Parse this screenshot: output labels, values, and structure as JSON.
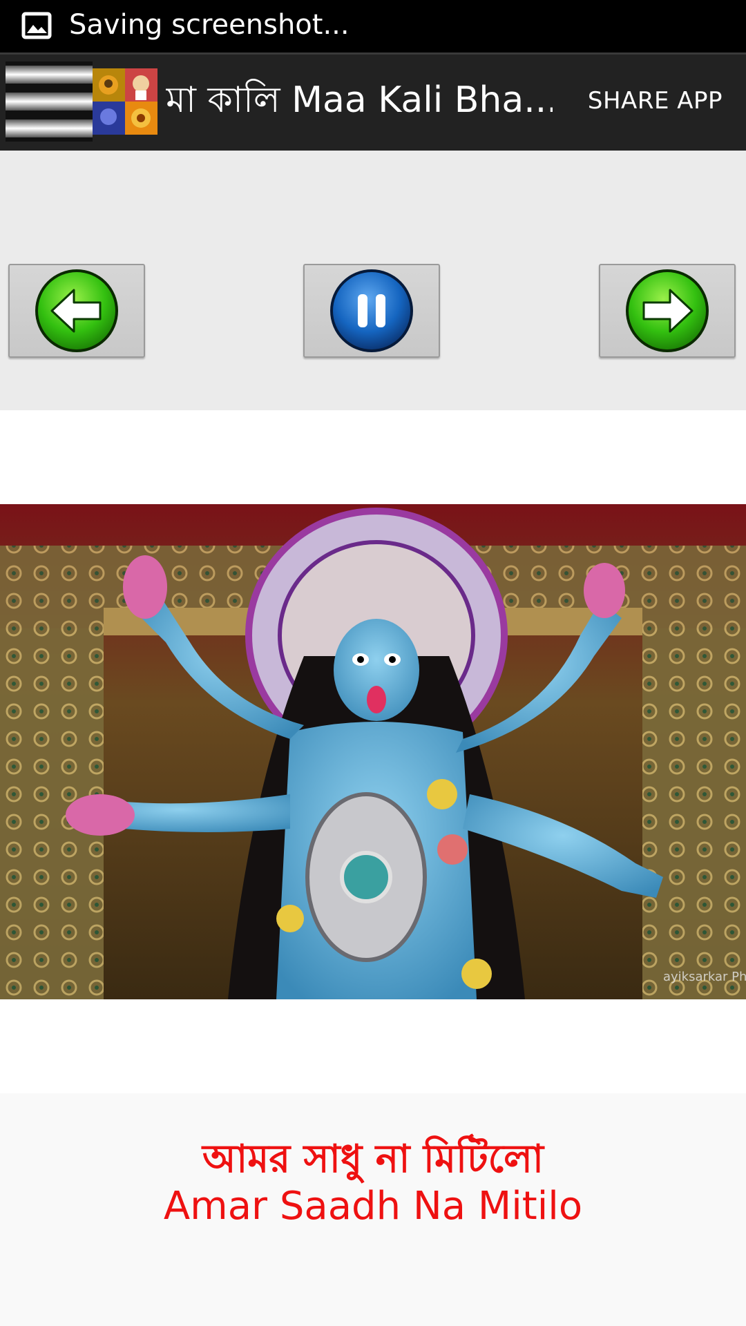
{
  "status_bar": {
    "icon": "image-icon",
    "text": "Saving screenshot..."
  },
  "action_bar": {
    "drawer_icon": "hamburger-menu-icon",
    "app_icon": "app-logo-icon",
    "title": "মা কালি Maa Kali Bha...",
    "share_label": "SHARE APP"
  },
  "controls": {
    "previous_icon": "arrow-left-icon",
    "pause_icon": "pause-icon",
    "next_icon": "arrow-right-icon"
  },
  "main_image": {
    "description_icon": "kali-idol-image",
    "watermark": "ayiksarkar Photography"
  },
  "song": {
    "title_bengali": "আমর সাধু না মিটিলো",
    "title_english": "Amar Saadh Na Mitilo"
  },
  "colors": {
    "status_bar": "#000000",
    "action_bar": "#222222",
    "controls_bg": "#ebebeb",
    "accent_red": "#ee1111",
    "button_green": "#33cc11",
    "button_blue": "#1565c0"
  }
}
